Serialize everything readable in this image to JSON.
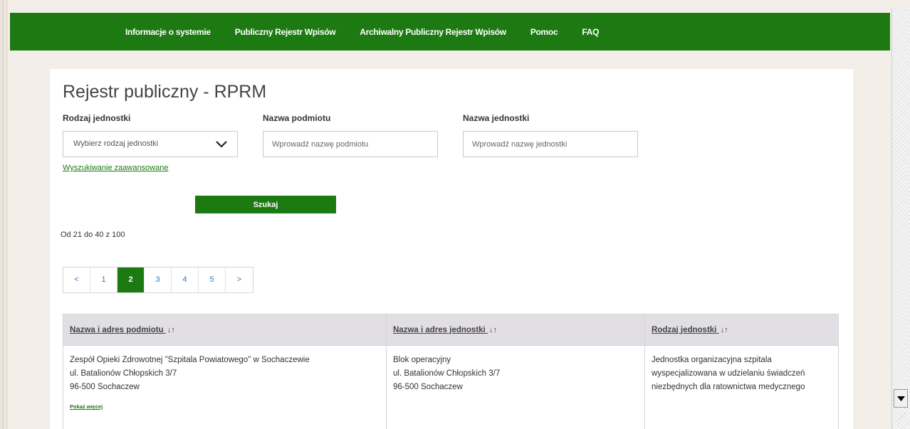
{
  "nav": {
    "items": [
      "Informacje o systemie",
      "Publiczny Rejestr Wpisów",
      "Archiwalny Publiczny Rejestr Wpisów",
      "Pomoc",
      "FAQ"
    ]
  },
  "page": {
    "title": "Rejestr publiczny - RPRM"
  },
  "filters": {
    "unit_type_label": "Rodzaj jednostki",
    "unit_type_value": "Wybierz rodzaj jednostki",
    "entity_name_label": "Nazwa podmiotu",
    "entity_name_placeholder": "Wprowadź nazwę podmiotu",
    "unit_name_label": "Nazwa jednostki",
    "unit_name_placeholder": "Wprowadź nazwę jednostki",
    "advanced_link": "Wyszukiwanie zaawansowane",
    "search_button": "Szukaj"
  },
  "results": {
    "range_text": "Od 21 do 40 z 100"
  },
  "pagination": {
    "prev": "<",
    "pages": [
      "1",
      "2",
      "3",
      "4",
      "5"
    ],
    "active": "2",
    "next": ">"
  },
  "table": {
    "headers": [
      "Nazwa i adres podmiotu",
      "Nazwa i adres jednostki",
      "Rodzaj jednostki"
    ],
    "sort_icon": "↓↑",
    "rows": [
      {
        "entity": [
          "Zespół Opieki Zdrowotnej \"Szpitala Powiatowego\" w Sochaczewie",
          "ul. Batalionów Chłopskich 3/7",
          "96-500 Sochaczew"
        ],
        "more_link": "Pokaż więcej",
        "unit": [
          "Blok operacyjny",
          "ul. Batalionów Chłopskich 3/7",
          "96-500 Sochaczew"
        ],
        "type": "Jednostka organizacyjna szpitala wyspecjalizowana w udzielaniu świadczeń niezbędnych dla ratownictwa medycznego"
      }
    ]
  },
  "colors": {
    "brand_green": "#1d7a12",
    "header_bg": "#e1dfe3"
  }
}
